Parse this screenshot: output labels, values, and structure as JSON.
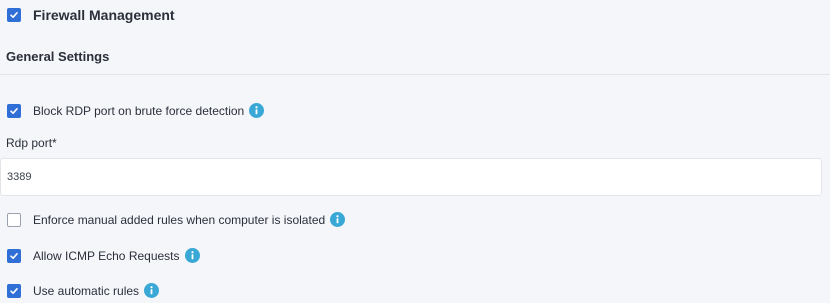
{
  "header": {
    "checked": true,
    "title": "Firewall Management"
  },
  "general": {
    "title": "General Settings",
    "block_rdp": {
      "checked": true,
      "label": "Block RDP port on brute force detection"
    },
    "rdp_port": {
      "label": "Rdp port*",
      "value": "3389"
    },
    "enforce_manual": {
      "checked": false,
      "label": "Enforce manual added rules when computer is isolated"
    },
    "allow_icmp": {
      "checked": true,
      "label": "Allow ICMP Echo Requests"
    },
    "auto_rules": {
      "checked": true,
      "label": "Use automatic rules"
    }
  },
  "icons": {
    "checkbox_check": "check-icon",
    "info": "info-icon"
  },
  "colors": {
    "accent": "#2f6fd6",
    "info": "#3aa8d6"
  }
}
